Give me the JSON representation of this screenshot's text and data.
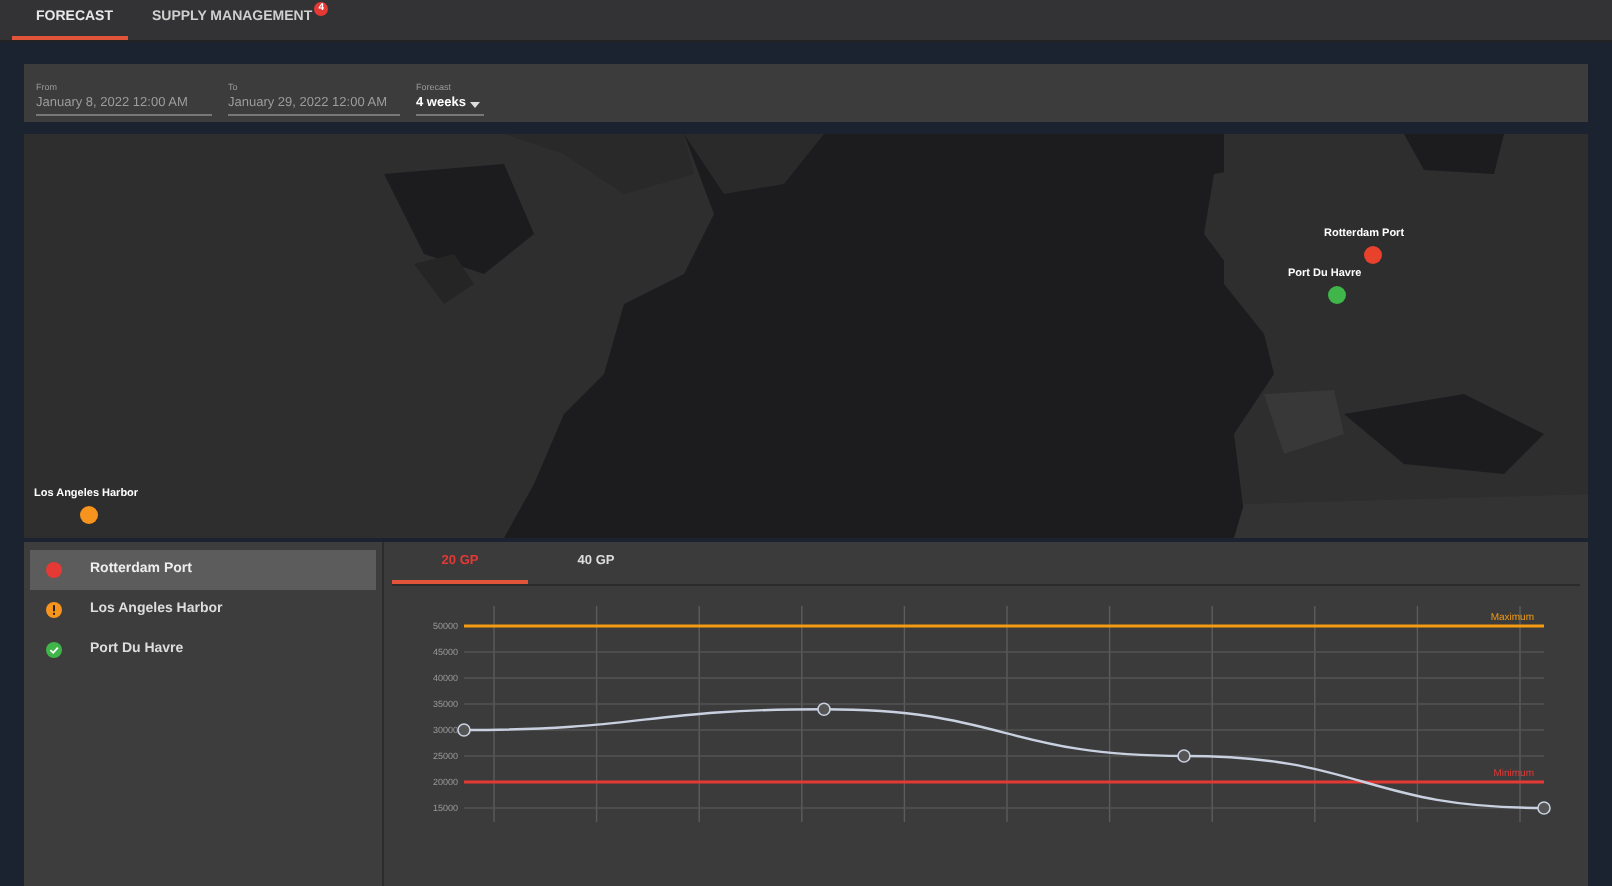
{
  "tabs": [
    {
      "label": "FORECAST",
      "selected": true
    },
    {
      "label": "SUPPLY MANAGEMENT",
      "selected": false,
      "badge": "4"
    }
  ],
  "filters": {
    "from": {
      "label": "From",
      "value": "January 8, 2022 12:00 AM"
    },
    "to": {
      "label": "To",
      "value": "January 29, 2022 12:00 AM"
    },
    "forecast": {
      "label": "Forecast",
      "value": "4 weeks"
    }
  },
  "map": {
    "kind": "picture",
    "markers": [
      {
        "label": "Los Angeles Harbor",
        "color": "#f7941d"
      },
      {
        "label": "Rotterdam Port",
        "color": "#e8412c"
      },
      {
        "label": "Port Du Havre",
        "color": "#3fb54a"
      }
    ]
  },
  "ports": [
    {
      "name": "Rotterdam Port",
      "kind": "error",
      "color": "#e53935",
      "selected": true
    },
    {
      "name": "Los Angeles Harbor",
      "kind": "warning",
      "color": "#f7941d",
      "selected": false
    },
    {
      "name": "Port Du Havre",
      "kind": "ok",
      "color": "#3fb54a",
      "selected": false
    }
  ],
  "chart_tabs": [
    {
      "label": "20 GP",
      "selected": true
    },
    {
      "label": "40 GP",
      "selected": false
    }
  ],
  "chart_data": {
    "type": "line",
    "grid": true,
    "ylim": [
      15000,
      50000
    ],
    "yticks": [
      15000,
      20000,
      25000,
      30000,
      35000,
      40000,
      45000,
      50000
    ],
    "series": [
      {
        "color": "#c9d1e0",
        "marker": "circle",
        "values": [
          30000,
          34000,
          25000,
          15000
        ]
      }
    ],
    "ref_lines": [
      {
        "axis": "y",
        "value": 50000,
        "label": "Maximum",
        "color": "#f39c12"
      },
      {
        "axis": "y",
        "value": 20000,
        "label": "Minimum",
        "color": "#e53935"
      }
    ]
  }
}
